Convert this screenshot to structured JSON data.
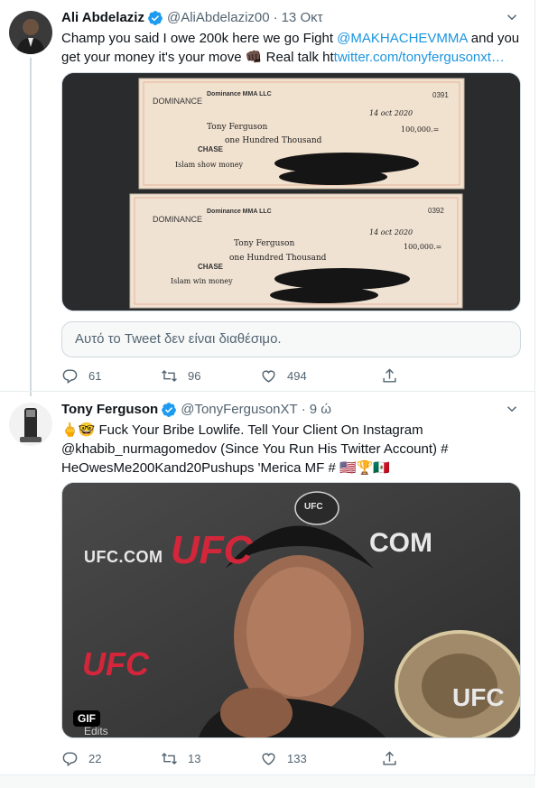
{
  "tweets": [
    {
      "name": "Ali Abdelaziz",
      "handle": "@AliAbdelaziz00",
      "time": "13 Οκτ",
      "text_part1": "Champ you said I owe 200k here we go Fight ",
      "mention": "@MAKHACHEVMMA",
      "text_part2": " and you get your money it's your move 👊🏿 Real talk ",
      "link_prefix": "ht",
      "link": "twitter.com/tonyfergusonxt…",
      "checks": [
        {
          "company": "Dominance MMA LLC",
          "number": "0391",
          "date": "14 oct 2020",
          "payee": "Tony Ferguson",
          "amount_numeric": "100,000.=",
          "amount_words": "one Hundred Thousand",
          "memo": "Islam show money",
          "bank": "CHASE"
        },
        {
          "company": "Dominance MMA LLC",
          "number": "0392",
          "date": "14 oct 2020",
          "payee": "Tony Ferguson",
          "amount_numeric": "100,000.=",
          "amount_words": "one Hundred Thousand",
          "memo": "Islam win money",
          "bank": "CHASE"
        }
      ],
      "unavailable": "Αυτό το Tweet δεν είναι διαθέσιμο.",
      "replies": "61",
      "retweets": "96",
      "likes": "494"
    },
    {
      "name": "Tony Ferguson",
      "handle": "@TonyFergusonXT",
      "time": "9 ώ",
      "line1": "🖕🤓 Fuck Your Bribe Lowlife. Tell Your Client On Instagram",
      "line2": "@khabib_nurmagomedov (Since You Run His Twitter Account) #",
      "line3": "HeOwesMe200Kand20Pushups 'Merica MF # 🇺🇸🏆🇲🇽",
      "gif_label": "GIF",
      "gif_texts": {
        "ufc_com_left": "UFC.COM",
        "ufc_big": "UFC",
        "com_right": "COM",
        "ufc_bottom_left": "UFC",
        "ufc_bottom_right": "UFC",
        "ufc_cap": "UFC",
        "edits": "Edits"
      },
      "replies": "22",
      "retweets": "13",
      "likes": "133"
    }
  ],
  "colors": {
    "accent": "#1b95e0",
    "verified": "#1d9bf0",
    "muted": "#536471"
  }
}
